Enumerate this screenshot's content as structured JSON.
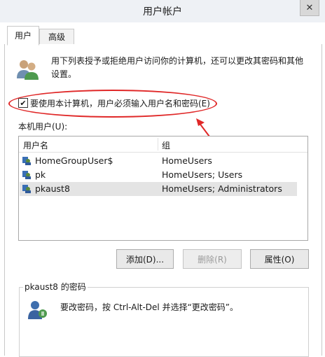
{
  "window": {
    "title": "用户帐户",
    "close_glyph": "✕"
  },
  "tabs": [
    {
      "label": "用户",
      "active": true
    },
    {
      "label": "高级",
      "active": false
    }
  ],
  "intro_text": "用下列表授予或拒绝用户访问你的计算机，还可以更改其密码和其他设置。",
  "checkbox": {
    "label": "要使用本计算机，用户必须输入用户名和密码(E)",
    "checked": true,
    "check_glyph": "✔"
  },
  "users_label": "本机用户(U):",
  "list": {
    "columns": [
      "用户名",
      "组"
    ],
    "rows": [
      {
        "name": "HomeGroupUser$",
        "group": "HomeUsers"
      },
      {
        "name": "pk",
        "group": "HomeUsers; Users"
      },
      {
        "name": "pkaust8",
        "group": "HomeUsers; Administrators"
      }
    ]
  },
  "buttons": {
    "add": "添加(D)...",
    "delete": "删除(R)",
    "properties": "属性(O)"
  },
  "password_group": {
    "title": "pkaust8 的密码",
    "text": "要改密码，按 Ctrl-Alt-Del 并选择“更改密码”。"
  },
  "colors": {
    "annotation_red": "#e02828",
    "selected_row": "#e4e4e4"
  }
}
